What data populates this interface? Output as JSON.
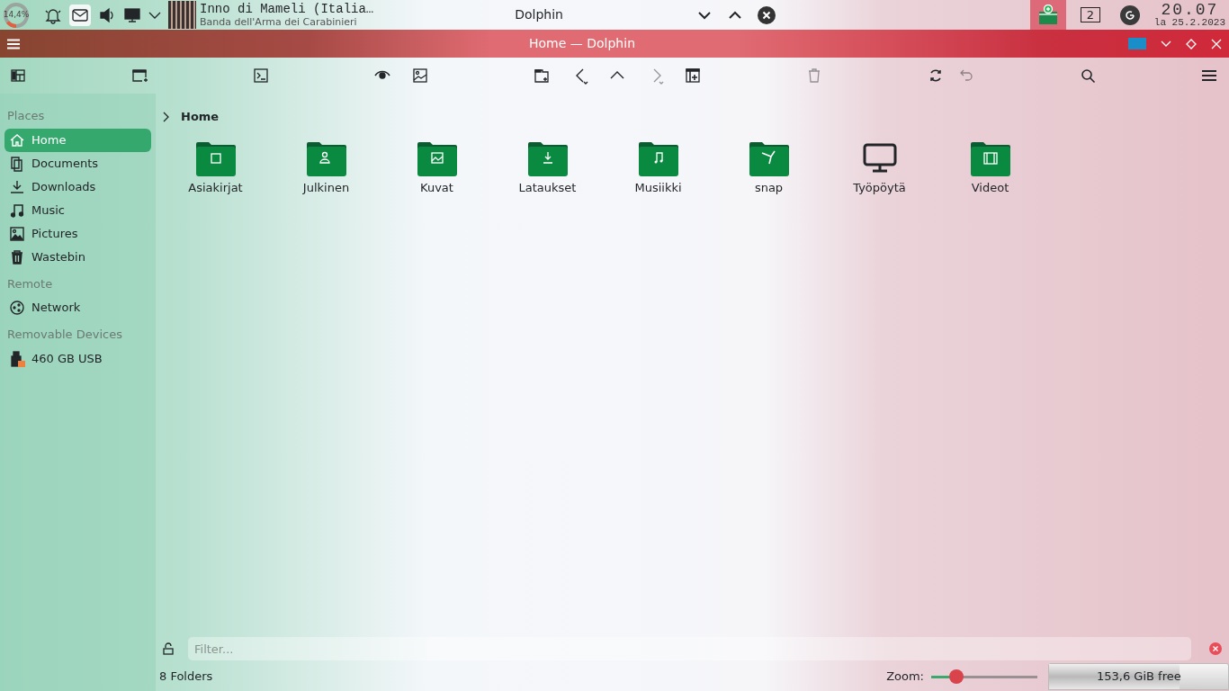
{
  "panel": {
    "cpu": {
      "reading": "14,4%",
      "level": 0.144
    },
    "media": {
      "title": "Inno di Mameli (Italia…",
      "artist": "Banda dell'Arma dei Carabinieri"
    },
    "task": "Dolphin",
    "pager": "2",
    "clock": {
      "time": "20.07",
      "date": "la 25.2.2023"
    }
  },
  "window": {
    "title": "Home — Dolphin"
  },
  "toolbar": [
    {
      "disabled": false
    },
    {
      "disabled": false
    },
    {
      "disabled": false
    },
    {
      "disabled": false
    },
    {
      "disabled": false
    },
    {
      "disabled": false
    },
    {
      "disabled": false
    },
    {
      "disabled": false
    },
    {
      "disabled": true
    },
    {
      "disabled": false
    },
    {
      "disabled": true
    },
    {
      "disabled": false
    },
    {
      "disabled": true
    },
    {
      "disabled": false
    },
    {
      "disabled": false
    }
  ],
  "sidebar": [
    {
      "heading": "Places",
      "items": [
        {
          "label": "Home",
          "selected": true
        },
        {
          "label": "Documents",
          "selected": false
        },
        {
          "label": "Downloads",
          "selected": false
        },
        {
          "label": "Music",
          "selected": false
        },
        {
          "label": "Pictures",
          "selected": false
        },
        {
          "label": "Wastebin",
          "selected": false
        }
      ]
    },
    {
      "heading": "Remote",
      "items": [
        {
          "label": "Network",
          "selected": false
        }
      ]
    },
    {
      "heading": "Removable Devices",
      "items": [
        {
          "label": "460 GB USB",
          "selected": false
        }
      ]
    }
  ],
  "breadcrumb": "Home",
  "files": [
    {
      "name": "Asiakirjat",
      "kind": "folder"
    },
    {
      "name": "Julkinen",
      "kind": "folder"
    },
    {
      "name": "Kuvat",
      "kind": "folder"
    },
    {
      "name": "Lataukset",
      "kind": "folder"
    },
    {
      "name": "Musiikki",
      "kind": "folder"
    },
    {
      "name": "snap",
      "kind": "folder"
    },
    {
      "name": "Työpöytä",
      "kind": "monitor"
    },
    {
      "name": "Videot",
      "kind": "folder"
    }
  ],
  "filter": {
    "placeholder": "Filter..."
  },
  "status": {
    "count": "8 Folders",
    "zoom_label": "Zoom:",
    "zoom": {
      "level": 0.24
    },
    "space": {
      "reading": "153,6 GiB free",
      "level": 0.73
    }
  }
}
